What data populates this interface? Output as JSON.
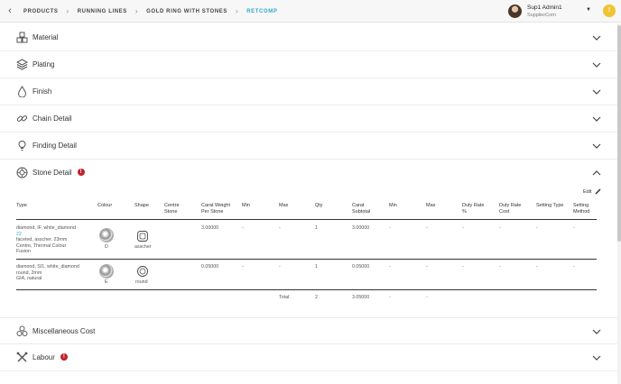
{
  "breadcrumbs": [
    "PRODUCTS",
    "RUNNING LINES",
    "GOLD RING WITH STONES",
    "RETCOMP"
  ],
  "user": {
    "name": "Sup1 Admin1",
    "org": "SupplierCom"
  },
  "notification": {
    "badge": "!",
    "badge_color": "#f1c232"
  },
  "sections": {
    "material": "Material",
    "plating": "Plating",
    "finish": "Finish",
    "chain": "Chain Detail",
    "finding": "Finding Detail",
    "stone": "Stone Detail",
    "misc": "Miscellaneous Cost",
    "labour": "Labour"
  },
  "warning_badge": "!",
  "stone_table": {
    "edit_label": "Edit",
    "headers": {
      "type": "Type",
      "colour": "Colour",
      "shape": "Shape",
      "centre": "Centre Stone",
      "carat_weight": "Carat Weight Per Stone",
      "min1": "Min",
      "max1": "Max",
      "qty": "Qty",
      "carat_subtotal": "Carat Subtotal",
      "min2": "Min",
      "max2": "Max",
      "duty_rate": "Duty Rate %",
      "duty_cost": "Duty Rate Cost",
      "setting_type": "Setting Type",
      "setting_method": "Setting Method"
    },
    "rows": [
      {
        "type_line1": "diamond, IF, white_diamond",
        "type_link": "22",
        "type_line2": "faceted, asscher, 23mm",
        "type_line3": "Centre, Thermal Colour",
        "type_line4": "Fusion",
        "colour": "D",
        "shape": "asscher",
        "centre": "",
        "carat_weight": "3.00000",
        "min1": "-",
        "max1": "-",
        "qty": "1",
        "carat_subtotal": "3.00000",
        "min2": "-",
        "max2": "-",
        "duty_rate": "-",
        "duty_cost": "-",
        "setting_type": "-",
        "setting_method": "-"
      },
      {
        "type_line1": "diamond, SI1, white_diamond",
        "type_line2": "round, 2mm",
        "type_line3": "GIA, natural",
        "colour": "E",
        "shape": "round",
        "centre": "",
        "carat_weight": "0.05000",
        "min1": "-",
        "max1": "-",
        "qty": "1",
        "carat_subtotal": "0.05000",
        "min2": "-",
        "max2": "-",
        "duty_rate": "-",
        "duty_cost": "-",
        "setting_type": "-",
        "setting_method": "-"
      }
    ],
    "totals": {
      "label": "Total:",
      "qty": "2",
      "carat_subtotal": "3.05000",
      "min2": "-",
      "max2": "-"
    }
  },
  "colors": {
    "accent": "#33a9c9",
    "warning": "#c0212a"
  }
}
